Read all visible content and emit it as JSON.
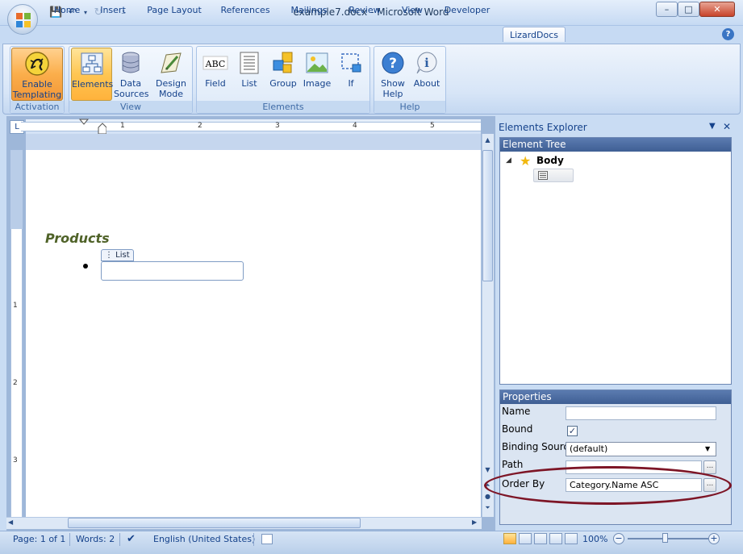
{
  "window": {
    "title": "example7.docx - Microsoft Word",
    "minimize": "–",
    "maximize": "□",
    "close": "✕"
  },
  "tabs": [
    "Home",
    "Insert",
    "Page Layout",
    "References",
    "Mailings",
    "Review",
    "View",
    "Developer",
    "LizardDocs"
  ],
  "active_tab": "LizardDocs",
  "ribbon": {
    "groups": [
      {
        "label": "Activation",
        "buttons": [
          {
            "label1": "Enable",
            "label2": "Templating",
            "icon": "lizard-icon"
          }
        ]
      },
      {
        "label": "View",
        "buttons": [
          {
            "label1": "Elements",
            "label2": "",
            "icon": "element-tree-icon"
          },
          {
            "label1": "Data",
            "label2": "Sources",
            "icon": "database-icon"
          },
          {
            "label1": "Design",
            "label2": "Mode",
            "icon": "design-mode-icon"
          }
        ]
      },
      {
        "label": "Elements",
        "buttons": [
          {
            "label1": "Field",
            "label2": "",
            "icon": "abc-field-icon"
          },
          {
            "label1": "List",
            "label2": "",
            "icon": "list-icon"
          },
          {
            "label1": "Group",
            "label2": "",
            "icon": "group-icon"
          },
          {
            "label1": "Image",
            "label2": "",
            "icon": "image-icon"
          },
          {
            "label1": "If",
            "label2": "",
            "icon": "if-icon"
          }
        ]
      },
      {
        "label": "Help",
        "buttons": [
          {
            "label1": "Show",
            "label2": "Help",
            "icon": "help-question-icon"
          },
          {
            "label1": "About",
            "label2": "",
            "icon": "info-icon"
          }
        ]
      }
    ]
  },
  "ruler": {
    "h_numbers": [
      "1",
      "2",
      "3",
      "4",
      "5"
    ],
    "v_numbers": [
      "1",
      "2",
      "3"
    ],
    "corner": "L"
  },
  "document": {
    "heading": "Products",
    "list_tag": "⋮ List"
  },
  "explorer": {
    "title": "Elements Explorer",
    "tree_header": "Element Tree",
    "root_label": "Body",
    "properties_header": "Properties",
    "properties": {
      "name_label": "Name",
      "name_value": "",
      "bound_label": "Bound",
      "bound_checked": "✓",
      "binding_source_label": "Binding Source",
      "binding_source_value": "(default)",
      "path_label": "Path",
      "path_value": "",
      "order_by_label": "Order By",
      "order_by_value": "Category.Name ASC",
      "browse": "..."
    }
  },
  "statusbar": {
    "page": "Page: 1 of 1",
    "words": "Words: 2",
    "language": "English (United States)",
    "zoom": "100%"
  },
  "colors": {
    "accent": "#15428b",
    "ribbon_active": "#ffc652",
    "annotation": "#7d1526",
    "heading": "#4f6228"
  }
}
